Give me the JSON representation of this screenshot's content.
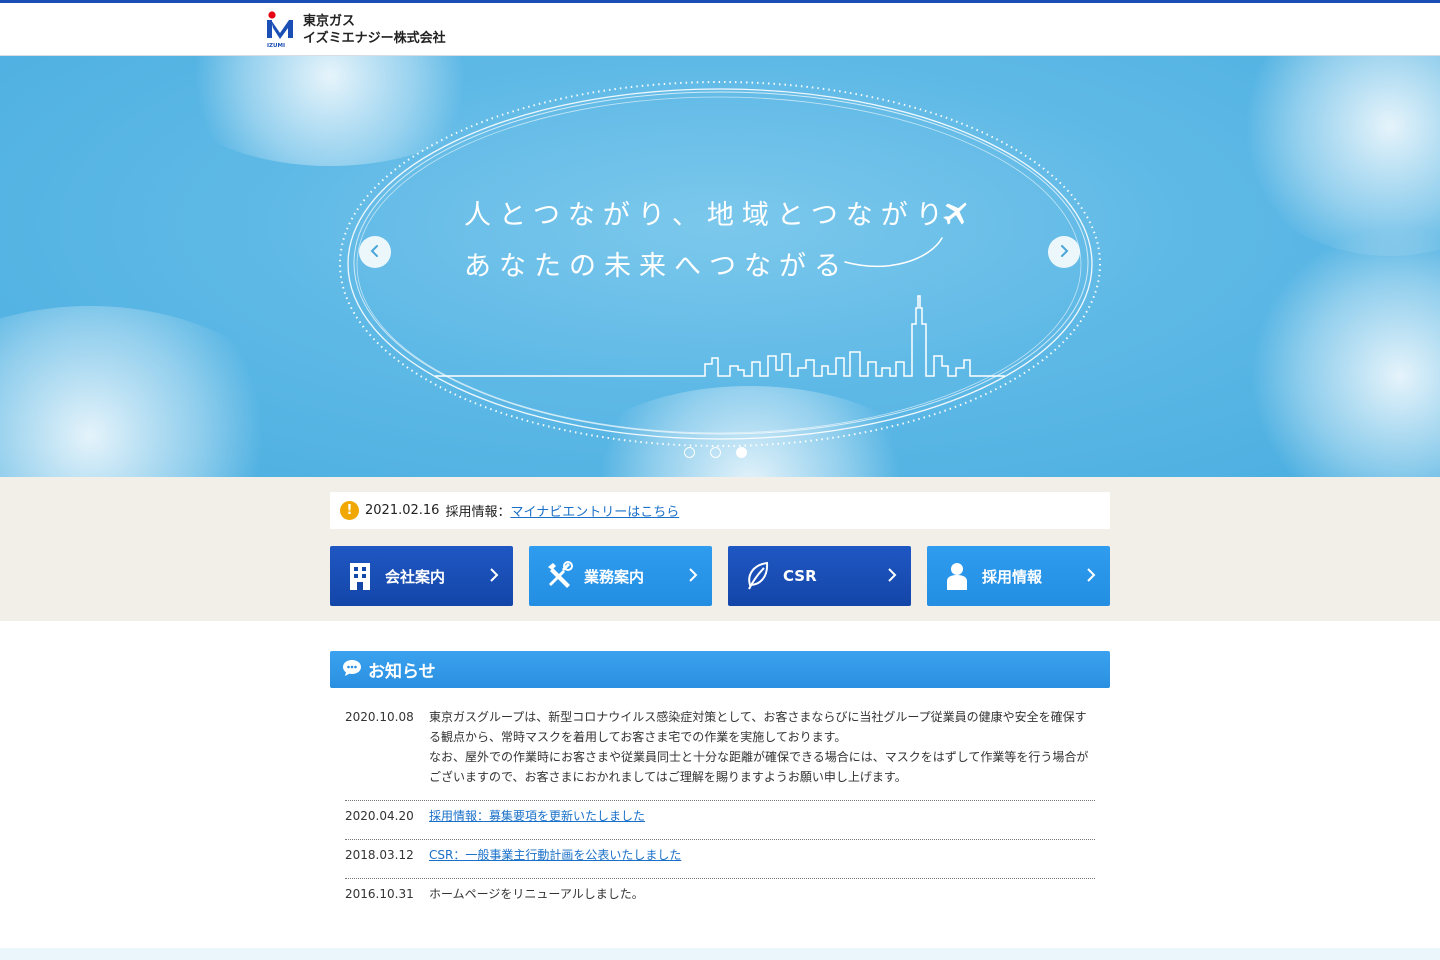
{
  "header": {
    "company_line1": "東京ガス",
    "company_line2": "イズミエナジー株式会社",
    "logo_caption": "IZUMI"
  },
  "hero": {
    "line1": "人とつながり、地域とつながり",
    "line2": "あなたの未来へつながる",
    "slides_total": 3,
    "active_slide": 3
  },
  "alert": {
    "icon": "exclamation-icon",
    "date": "2021.02.16",
    "label": "採用情報：",
    "link": "マイナビエントリーはこちら"
  },
  "nav": [
    {
      "label": "会社案内",
      "icon": "building-icon",
      "style": "dark"
    },
    {
      "label": "業務案内",
      "icon": "tools-icon",
      "style": "light"
    },
    {
      "label": "CSR",
      "icon": "leaf-icon",
      "style": "dark"
    },
    {
      "label": "採用情報",
      "icon": "person-icon",
      "style": "light"
    }
  ],
  "news": {
    "title": "お知らせ",
    "items": [
      {
        "date": "2020.10.08",
        "text": "東京ガスグループは、新型コロナウイルス感染症対策として、お客さまならびに当社グループ従業員の健康や安全を確保する観点から、常時マスクを着用してお客さま宅での作業を実施しております。",
        "text2": "なお、屋外での作業時にお客さまや従業員同士と十分な距離が確保できる場合には、マスクをはずして作業等を行う場合がございますので、お客さまにおかれましてはご理解を賜りますようお願い申し上げます。"
      },
      {
        "date": "2020.04.20",
        "link": "採用情報：募集要項を更新いたしました"
      },
      {
        "date": "2018.03.12",
        "link": "CSR：一般事業主行動計画を公表いたしました"
      },
      {
        "date": "2016.10.31",
        "text": "ホームページをリニューアルしました。"
      }
    ]
  },
  "colors": {
    "brand_dark": "#1446a8",
    "brand_light": "#238ee2",
    "band_bg": "#f2efe8",
    "link": "#1a70c8"
  }
}
